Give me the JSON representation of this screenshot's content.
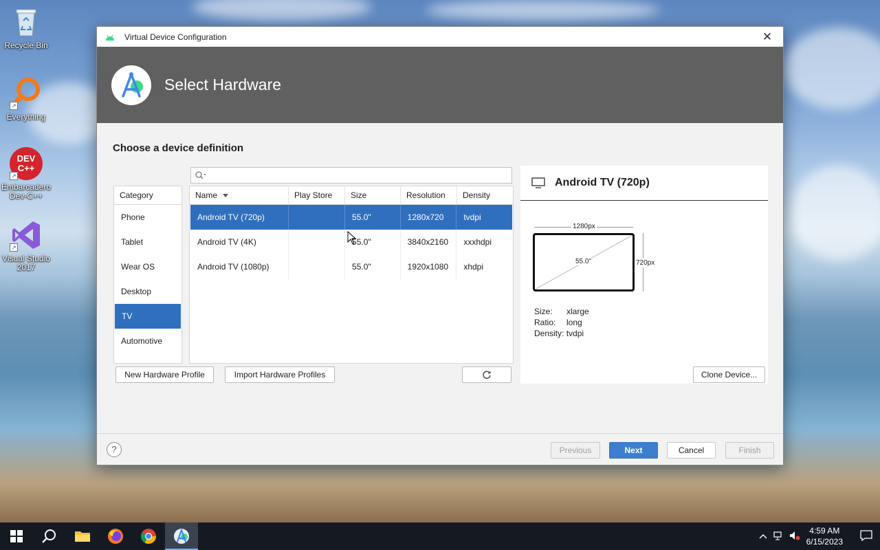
{
  "desktop": {
    "icons": [
      {
        "label": "Recycle Bin"
      },
      {
        "label": "Everything"
      },
      {
        "label": "Embarcadero Dev-C++",
        "logo_text": "DEV\nC++"
      },
      {
        "label": "Visual Studio 2017"
      }
    ]
  },
  "dialog": {
    "window_title": "Virtual Device Configuration",
    "close_glyph": "✕",
    "banner_title": "Select Hardware",
    "section_title": "Choose a device definition",
    "search": {
      "value": "",
      "placeholder": ""
    },
    "category": {
      "header": "Category",
      "items": [
        "Phone",
        "Tablet",
        "Wear OS",
        "Desktop",
        "TV",
        "Automotive"
      ],
      "selected": "TV"
    },
    "table": {
      "columns": [
        "Name",
        "Play Store",
        "Size",
        "Resolution",
        "Density"
      ],
      "rows": [
        {
          "name": "Android TV (720p)",
          "play_store": "",
          "size": "55.0\"",
          "resolution": "1280x720",
          "density": "tvdpi",
          "selected": true
        },
        {
          "name": "Android TV (4K)",
          "play_store": "",
          "size": "55.0\"",
          "resolution": "3840x2160",
          "density": "xxxhdpi",
          "selected": false
        },
        {
          "name": "Android TV (1080p)",
          "play_store": "",
          "size": "55.0\"",
          "resolution": "1920x1080",
          "density": "xhdpi",
          "selected": false
        }
      ]
    },
    "buttons": {
      "new_profile": "New Hardware Profile",
      "import_profiles": "Import Hardware Profiles",
      "clone_device": "Clone Device..."
    },
    "detail": {
      "name": "Android TV (720p)",
      "width_label": "1280px",
      "height_label": "720px",
      "diagonal_label": "55.0\"",
      "specs": [
        {
          "key": "Size:",
          "value": "xlarge"
        },
        {
          "key": "Ratio:",
          "value": "long"
        },
        {
          "key": "Density:",
          "value": "tvdpi"
        }
      ]
    },
    "footer": {
      "help": "?",
      "previous": "Previous",
      "next": "Next",
      "cancel": "Cancel",
      "finish": "Finish"
    }
  },
  "taskbar": {
    "time": "4:59 AM",
    "date": "6/15/2023",
    "active_app": "Android Studio"
  },
  "colors": {
    "accent": "#2f6fbe",
    "banner": "#606060",
    "taskbar": "#151a22"
  }
}
